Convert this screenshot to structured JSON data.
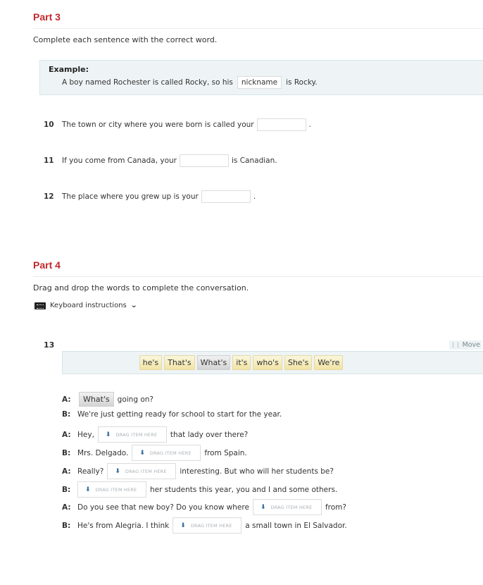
{
  "part3": {
    "title": "Part 3",
    "instruction": "Complete each sentence with the correct word.",
    "example": {
      "label": "Example:",
      "before": "A boy named Rochester is called Rocky, so his",
      "answer": "nickname",
      "after": "is Rocky."
    },
    "questions": [
      {
        "number": "10",
        "before": "The town or city where you were born is called your",
        "value": "",
        "after": "."
      },
      {
        "number": "11",
        "before": "If you come from Canada, your",
        "value": "",
        "after": "is Canadian."
      },
      {
        "number": "12",
        "before": "The place where you grew up is your",
        "value": "",
        "after": "."
      }
    ]
  },
  "part4": {
    "title": "Part 4",
    "instruction": "Drag and drop the words to complete the conversation.",
    "keyboard_instructions": "Keyboard instructions",
    "question_number": "13",
    "move_label": "Move",
    "word_bank": [
      {
        "word": "he's",
        "used": false
      },
      {
        "word": "That's",
        "used": false
      },
      {
        "word": "What's",
        "used": true
      },
      {
        "word": "it's",
        "used": false
      },
      {
        "word": "who's",
        "used": false
      },
      {
        "word": "She's",
        "used": false
      },
      {
        "word": "We're",
        "used": false
      }
    ],
    "dropzone_placeholder": "DRAG ITEM HERE",
    "conversation": [
      {
        "speaker": "A:",
        "before": "",
        "filled": "What's",
        "after": "going on?"
      },
      {
        "speaker": "B:",
        "text": "We're just getting ready for school to start for the year."
      },
      {
        "speaker": "A:",
        "before": "Hey,",
        "after": "that lady over there?"
      },
      {
        "speaker": "B:",
        "before": "Mrs. Delgado.",
        "after": "from Spain."
      },
      {
        "speaker": "A:",
        "before": "Really?",
        "after": "interesting. But who will her students be?"
      },
      {
        "speaker": "B:",
        "before": "",
        "after": "her students this year, you and I and some others."
      },
      {
        "speaker": "A:",
        "before": "Do you see that new boy? Do you know where",
        "after": "from?"
      },
      {
        "speaker": "B:",
        "before": "He's from Alegria. I think",
        "after": "a small town in El Salvador."
      }
    ]
  }
}
